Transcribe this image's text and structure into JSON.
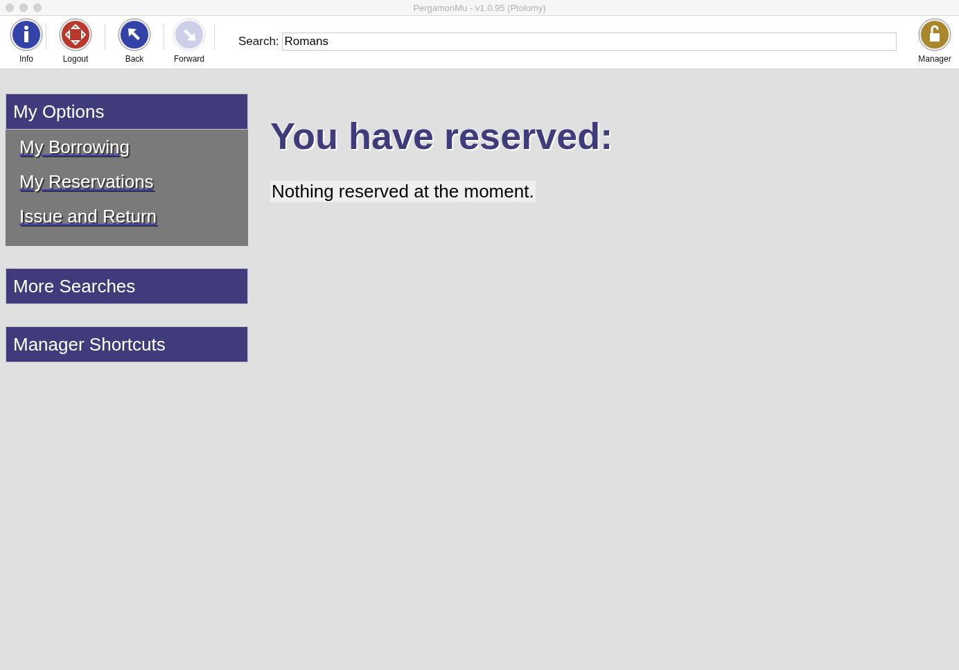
{
  "window": {
    "title": "PergamonMu - v1.0.95 (Ptolomy)"
  },
  "toolbar": {
    "buttons": [
      {
        "kind": "info",
        "label": "Info",
        "disabled": false
      },
      {
        "kind": "logout",
        "label": "Logout",
        "disabled": false
      },
      {
        "kind": "back",
        "label": "Back",
        "disabled": false
      },
      {
        "kind": "forward",
        "label": "Forward",
        "disabled": true
      }
    ],
    "search": {
      "label": "Search:",
      "value": "Romans"
    },
    "manager": {
      "kind": "lock",
      "label": "Manager",
      "disabled": false
    }
  },
  "sidebar": {
    "panels": [
      {
        "title": "My Options",
        "expanded": true,
        "items": [
          "My Borrowing",
          "My Reservations",
          "Issue and Return"
        ]
      },
      {
        "title": "More Searches",
        "expanded": false
      },
      {
        "title": "Manager Shortcuts",
        "expanded": false
      }
    ]
  },
  "content": {
    "heading": "You have reserved:",
    "message": "Nothing reserved at the moment."
  }
}
